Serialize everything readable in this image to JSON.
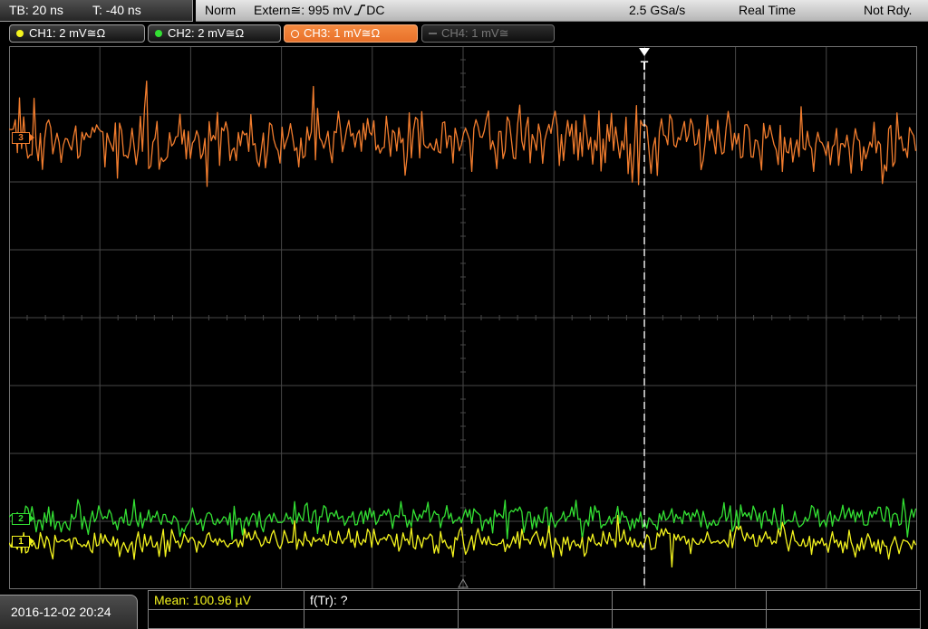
{
  "status_bar": {
    "timebase": "TB: 20 ns",
    "trigger_offset": "T: -40 ns",
    "trigger_mode": "Norm",
    "trigger_source": "Extern≅: 995 mV",
    "trigger_slope_icon": "rising-edge-icon",
    "trigger_coupling": "DC",
    "sample_rate": "2.5 GSa/s",
    "acquisition": "Real Time",
    "status": "Not Rdy."
  },
  "channels": [
    {
      "label": "CH1: 2 mV≅Ω",
      "marker": "1",
      "color": "#f4f41e",
      "active": true,
      "selected": false
    },
    {
      "label": "CH2: 2 mV≅Ω",
      "marker": "2",
      "color": "#33e033",
      "active": true,
      "selected": false
    },
    {
      "label": "CH3: 1 mV≅Ω",
      "marker": "3",
      "color": "#f27d2e",
      "active": true,
      "selected": true
    },
    {
      "label": "CH4: 1 mV≅",
      "color": "#777777",
      "active": false,
      "selected": false
    }
  ],
  "display": {
    "trigger_marker": "T",
    "trigger_icon": "trigger-arrow-icon"
  },
  "measurements": {
    "rows": [
      [
        "Mean: 100.96 µV",
        "f(Tr): ?",
        "",
        "",
        ""
      ],
      [
        "",
        "",
        "",
        "",
        ""
      ]
    ]
  },
  "footer": {
    "datetime": "2016-12-02 20:24"
  }
}
